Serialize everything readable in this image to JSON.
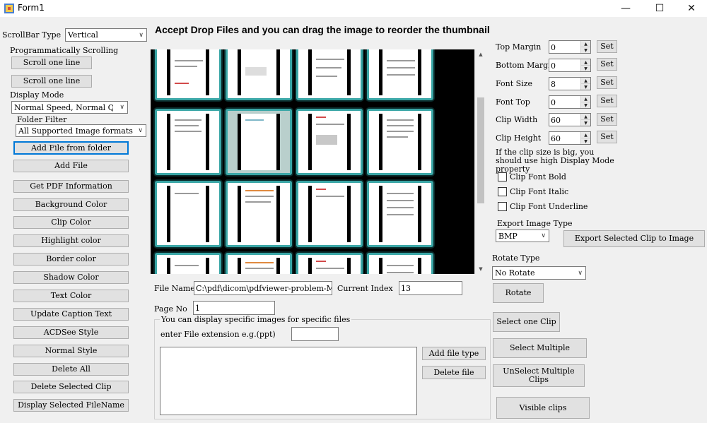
{
  "window": {
    "title": "Form1",
    "minimize": "—",
    "maximize": "☐",
    "close": "✕"
  },
  "header": "Accept Drop Files and you can drag the image to reorder the thumbnail",
  "left": {
    "scrollbar_type_label": "ScrollBar Type",
    "scrollbar_type_value": "Vertical",
    "prog_scroll_label": "Programmatically Scrolling",
    "scroll_btn_1": "Scroll one line",
    "scroll_btn_2": "Scroll one line",
    "display_mode_label": "Display Mode",
    "display_mode_value": "Normal Speed, Normal Quality",
    "folder_filter_label": "Folder Filter",
    "folder_filter_value": "All Supported Image formats",
    "buttons": [
      "Add File from folder",
      "Add File",
      "Get PDF Information",
      "Background Color",
      "Clip Color",
      "Highlight color",
      "Border color",
      "Shadow Color",
      "Text Color",
      "Update Caption Text",
      "ACDSee Style",
      "Normal Style",
      "Delete All",
      "Delete Selected Clip",
      "Display Selected FileName"
    ]
  },
  "bottom": {
    "file_name_label": "File Name",
    "file_name_value": "C:\\pdf\\dicom\\pdfviewer-problem-MS",
    "current_index_label": "Current Index",
    "current_index_value": "13",
    "page_no_label": "Page No",
    "page_no_value": "1",
    "group_title": "You can display specific images for specific files",
    "ext_label": "enter File extension e.g.(ppt)",
    "ext_value": "",
    "add_file_type": "Add file type",
    "delete_file": "Delete file"
  },
  "right": {
    "top_margin_label": "Top Margin",
    "top_margin_value": "0",
    "bottom_margin_label": "Bottom Margin",
    "bottom_margin_value": "0",
    "font_size_label": "Font Size",
    "font_size_value": "8",
    "font_top_label": "Font Top",
    "font_top_value": "0",
    "clip_width_label": "Clip Width",
    "clip_width_value": "60",
    "clip_height_label": "Clip Height",
    "clip_height_value": "60",
    "set_label": "Set",
    "clip_note": "If the clip size is big, you should use high Display Mode property",
    "chk_bold": "Clip Font Bold",
    "chk_italic": "Clip Font Italic",
    "chk_underline": "Clip Font Underline",
    "export_type_label": "Export Image Type",
    "export_type_value": "BMP",
    "export_btn": "Export Selected Clip to Image",
    "rotate_type_label": "Rotate Type",
    "rotate_type_value": "No Rotate",
    "rotate_btn": "Rotate",
    "select_one": "Select one Clip",
    "select_multiple": "Select Multiple",
    "unselect_multiple": "UnSelect Multiple Clips",
    "visible_clips": "Visible clips"
  }
}
